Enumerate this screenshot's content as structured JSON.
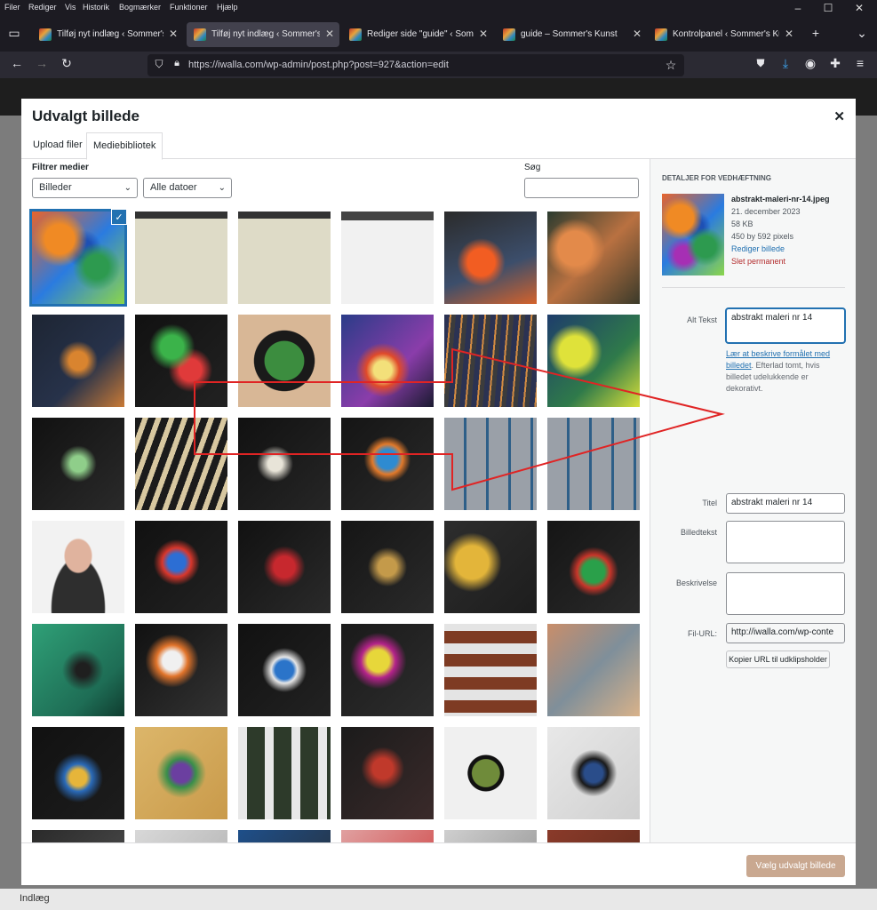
{
  "browser": {
    "menu": [
      "Filer",
      "Rediger",
      "Vis",
      "Historik",
      "Bogmærker",
      "Funktioner",
      "Hjælp"
    ],
    "tabs": [
      {
        "title": "Tilføj nyt indlæg ‹ Sommer's Ku",
        "active": false
      },
      {
        "title": "Tilføj nyt indlæg ‹ Sommer's Ku",
        "active": true
      },
      {
        "title": "Rediger side \"guide\" ‹ Sommer'",
        "active": false
      },
      {
        "title": "guide – Sommer's Kunst",
        "active": false
      },
      {
        "title": "Kontrolpanel ‹ Sommer's Kunst",
        "active": false
      }
    ],
    "url": "https://iwalla.com/wp-admin/post.php?post=927&action=edit"
  },
  "modal": {
    "title": "Udvalgt billede",
    "tabs": [
      "Upload filer",
      "Mediebibliotek"
    ],
    "active_tab": "Mediebibliotek",
    "filter_label": "Filtrer medier",
    "filter_type": "Billeder",
    "filter_date": "Alle datoer",
    "search_label": "Søg",
    "search_value": "",
    "select_button": "Vælg udvalgt billede"
  },
  "details": {
    "heading": "DETALJER FOR VEDHÆFTNING",
    "filename": "abstrakt-maleri-nr-14.jpeg",
    "date": "21. december 2023",
    "size": "58 KB",
    "dimensions": "450 by 592 pixels",
    "edit_link": "Rediger billede",
    "delete_link": "Slet permanent",
    "alt_label": "Alt Tekst",
    "alt_value": "abstrakt maleri nr 14",
    "help_link": "Lær at beskrive formålet med billedet",
    "help_text": ". Efterlad tomt, hvis billedet udelukkende er dekorativt.",
    "title_label": "Titel",
    "title_value": "abstrakt maleri nr 14",
    "caption_label": "Billedtekst",
    "caption_value": "",
    "desc_label": "Beskrivelse",
    "desc_value": "",
    "url_label": "Fil-URL:",
    "url_value": "http://iwalla.com/wp-conte",
    "copy_button": "Kopier URL til udklipsholder"
  },
  "background": {
    "footer_label": "Indlæg"
  },
  "colors": {
    "accent": "#2271b1",
    "primary_disabled": "#c9a890",
    "delete": "#b32d2e",
    "annotation_arrow": "#e02424"
  }
}
